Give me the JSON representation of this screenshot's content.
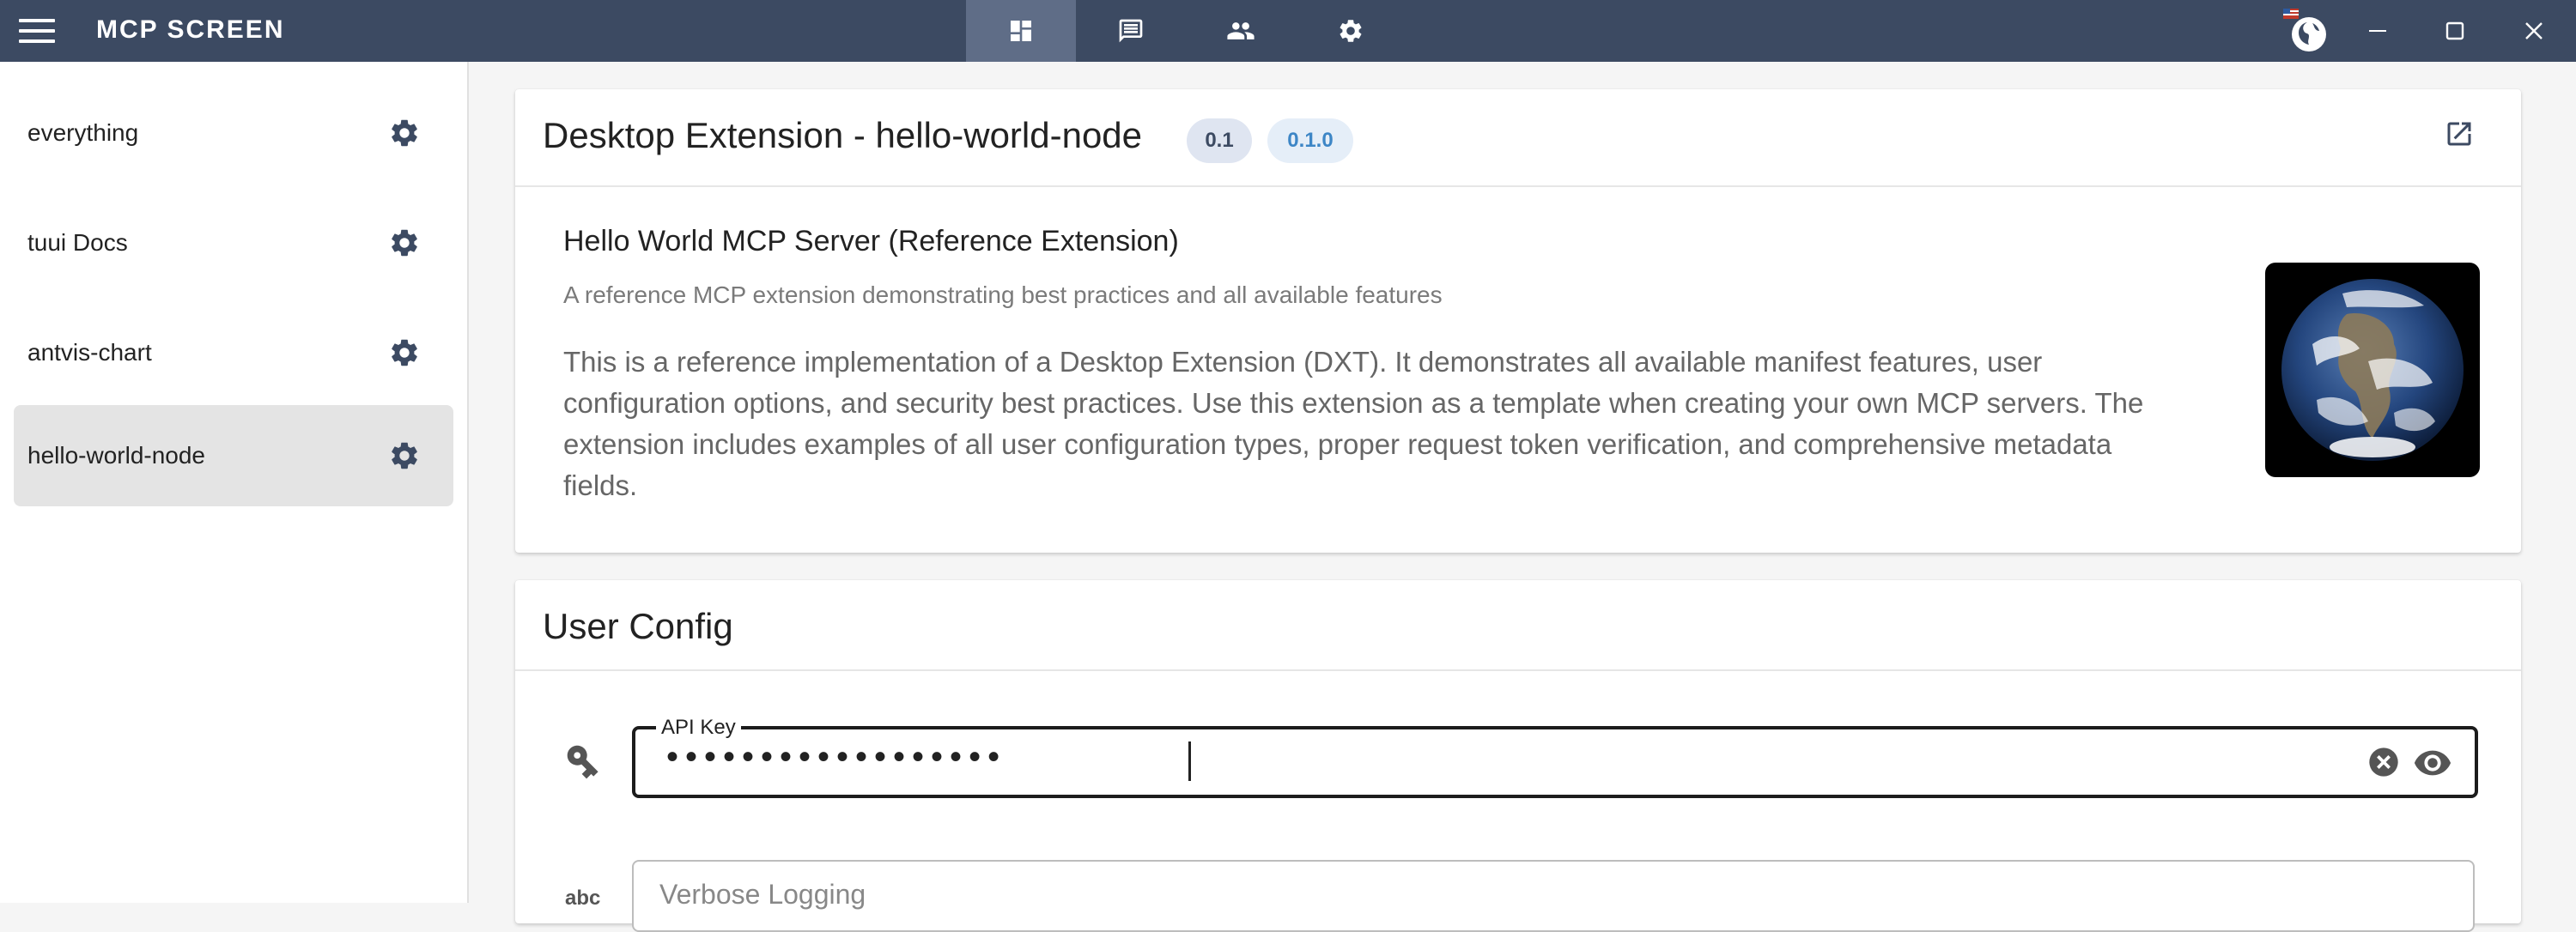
{
  "app": {
    "title": "MCP SCREEN"
  },
  "topnav": {
    "tabs": [
      {
        "icon": "dashboard-icon",
        "active": true
      },
      {
        "icon": "chat-icon",
        "active": false
      },
      {
        "icon": "people-icon",
        "active": false
      },
      {
        "icon": "settings-icon",
        "active": false
      }
    ],
    "right_icons": [
      "language-globe-icon",
      "minimize-icon",
      "maximize-icon",
      "close-icon"
    ]
  },
  "sidebar": {
    "items": [
      {
        "label": "everything",
        "active": false
      },
      {
        "label": "tuui Docs",
        "active": false
      },
      {
        "label": "antvis-chart",
        "active": false
      },
      {
        "label": "hello-world-node",
        "active": true
      }
    ]
  },
  "extension": {
    "title": "Desktop Extension - hello-world-node",
    "badge_spec": "0.1",
    "badge_version": "0.1.0",
    "server_name": "Hello World MCP Server (Reference Extension)",
    "short_description": "A reference MCP extension demonstrating best practices and all available features",
    "long_description": "This is a reference implementation of a Desktop Extension (DXT). It demonstrates all available manifest features, user configuration options, and security best practices. Use this extension as a template when creating your own MCP servers. The extension includes examples of all user configuration types, proper request token verification, and comprehensive metadata fields."
  },
  "user_config": {
    "title": "User Config",
    "api_key": {
      "label": "API Key",
      "masked_value": "••••••••••••••••••"
    },
    "verbose_logging": {
      "placeholder": "Verbose Logging"
    }
  },
  "colors": {
    "topbar": "#3c4a62",
    "active_tab": "#5f6d87",
    "badge_spec_bg": "#dfe5f1",
    "badge_version_text": "#3d86c6"
  }
}
